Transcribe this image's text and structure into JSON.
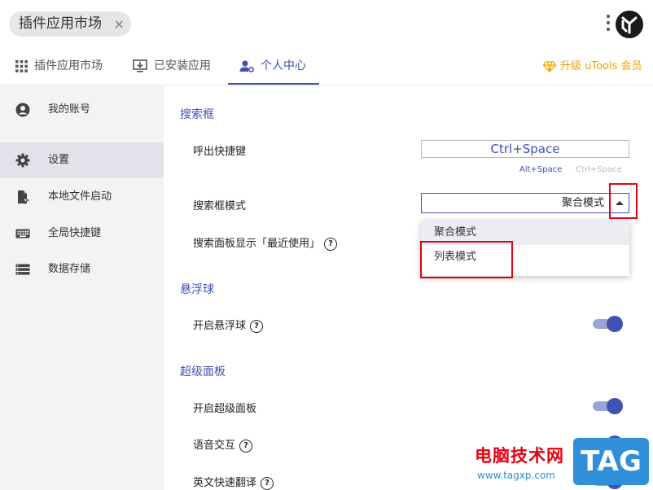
{
  "app_chip": {
    "label": "插件应用市场",
    "close": "×"
  },
  "tabs": [
    {
      "label": "插件应用市场"
    },
    {
      "label": "已安装应用"
    },
    {
      "label": "个人中心"
    }
  ],
  "upgrade_label": "升级 uTools 会员",
  "sidebar": {
    "items": [
      {
        "label": "我的账号"
      },
      {
        "label": "设置"
      },
      {
        "label": "本地文件启动"
      },
      {
        "label": "全局快捷键"
      },
      {
        "label": "数据存储"
      }
    ]
  },
  "settings": {
    "search_box": {
      "title": "搜索框",
      "hotkey_label": "呼出快捷键",
      "hotkey_value": "Ctrl+Space",
      "alt_option_1": "Alt+Space",
      "alt_option_2": "Ctrl+Space",
      "mode_label": "搜索框模式",
      "mode_value": "聚合模式",
      "mode_options": [
        "聚合模式",
        "列表模式"
      ],
      "recent_label": "搜索面板显示「最近使用」"
    },
    "floating_ball": {
      "title": "悬浮球",
      "enable_label": "开启悬浮球"
    },
    "super_panel": {
      "title": "超级面板",
      "enable_label": "开启超级面板",
      "voice_label": "语音交互",
      "translate_label": "英文快速翻译"
    },
    "help_glyph": "?"
  },
  "watermark": {
    "site_name": "电脑技术网",
    "url": "www.tagxp.com",
    "badge": "TAG"
  },
  "colors": {
    "accent": "#3f51b5",
    "upgrade": "#f2a200",
    "highlight": "#e60012"
  }
}
